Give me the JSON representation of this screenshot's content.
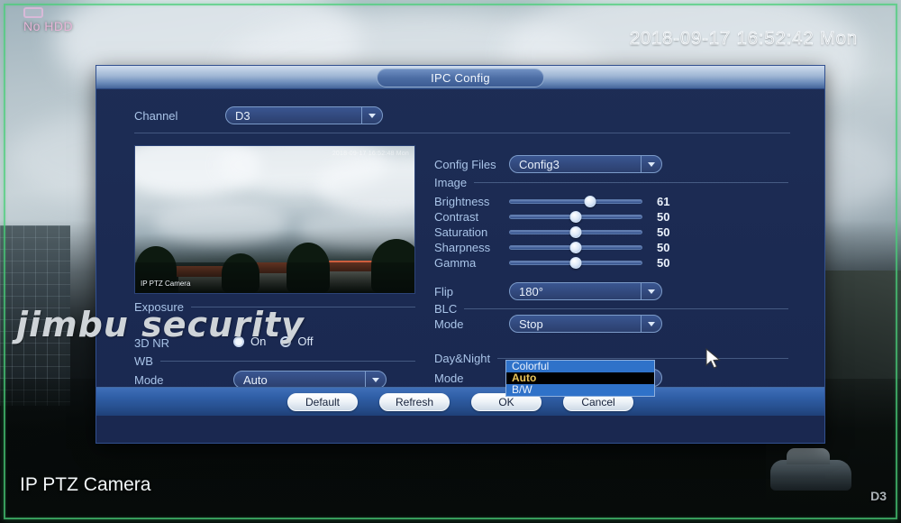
{
  "osd": {
    "hdd_status": "No HDD",
    "hdd_icon": "hdd-icon",
    "timestamp": "2018-09-17 16:52:42 Mon",
    "camera_name": "IP PTZ Camera",
    "channel_label": "D3"
  },
  "watermark": "jimbu security",
  "dialog": {
    "title": "IPC Config",
    "channel": {
      "label": "Channel",
      "value": "D3"
    },
    "preview": {
      "overlay_time": "2018-09-17 16:52:48 Mon",
      "overlay_name": "IP PTZ Camera"
    },
    "config_files": {
      "label": "Config Files",
      "value": "Config3"
    },
    "image_section": {
      "label": "Image",
      "sliders": [
        {
          "label": "Brightness",
          "value": "61",
          "percent": 61
        },
        {
          "label": "Contrast",
          "value": "50",
          "percent": 50
        },
        {
          "label": "Saturation",
          "value": "50",
          "percent": 50
        },
        {
          "label": "Sharpness",
          "value": "50",
          "percent": 50
        },
        {
          "label": "Gamma",
          "value": "50",
          "percent": 50
        }
      ]
    },
    "flip": {
      "label": "Flip",
      "value": "180°"
    },
    "blc_section": {
      "label": "BLC",
      "mode_label": "Mode",
      "mode_value": "Stop"
    },
    "daynight_section": {
      "label": "Day&Night",
      "mode_label": "Mode",
      "mode_value": "Auto",
      "options": [
        "Colorful",
        "Auto",
        "B/W"
      ],
      "selected_option": "Auto"
    },
    "exposure_section": {
      "label": "Exposure"
    },
    "nr3d": {
      "label": "3D NR",
      "on_label": "On",
      "off_label": "Off",
      "value": "On"
    },
    "wb_section": {
      "label": "WB",
      "mode_label": "Mode",
      "mode_value": "Auto"
    },
    "buttons": [
      {
        "label": "Default"
      },
      {
        "label": "Refresh"
      },
      {
        "label": "OK"
      },
      {
        "label": "Cancel"
      }
    ]
  },
  "colors": {
    "dialog_bg": "#1c2b53",
    "accent_blue": "#2f72c9",
    "highlight_text": "#e8c45a",
    "label_blue": "#a9c4e8",
    "bezel_green": "#48ce78",
    "hdd_warning": "#e6b6d8"
  }
}
